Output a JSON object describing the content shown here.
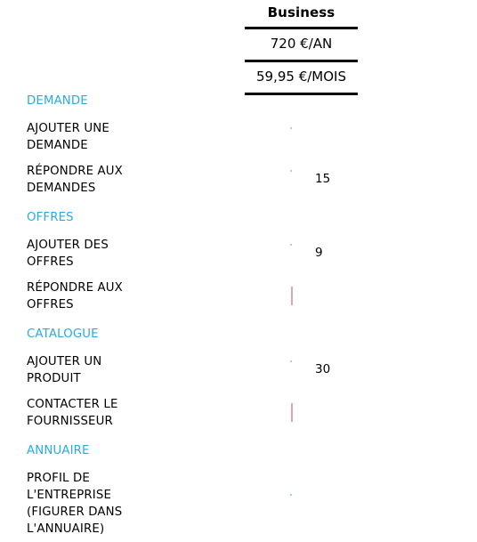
{
  "plan": {
    "name": "Business",
    "price_year": "720 €/AN",
    "price_month": "59,95 €/MOIS"
  },
  "colors": {
    "section_heading": "#29abe2",
    "label": "#000000",
    "rule": "#000000",
    "check_green": "#16b81c",
    "noentry_red": "#e02a1e"
  },
  "rows": [
    {
      "kind": "section",
      "label": "DEMANDE",
      "icon": "",
      "count": ""
    },
    {
      "kind": "feature",
      "label": "AJOUTER UNE DEMANDE",
      "icon": "check-icon",
      "count": ""
    },
    {
      "kind": "feature",
      "label": "RÉPONDRE AUX DEMANDES",
      "icon": "check-icon",
      "count": "15"
    },
    {
      "kind": "section",
      "label": "OFFRES",
      "icon": "",
      "count": ""
    },
    {
      "kind": "feature",
      "label": "AJOUTER DES OFFRES",
      "icon": "check-icon",
      "count": "9"
    },
    {
      "kind": "feature",
      "label": "RÉPONDRE AUX OFFRES",
      "icon": "no-entry-icon",
      "count": ""
    },
    {
      "kind": "section",
      "label": "CATALOGUE",
      "icon": "",
      "count": ""
    },
    {
      "kind": "feature",
      "label": "AJOUTER UN PRODUIT",
      "icon": "check-icon",
      "count": "30"
    },
    {
      "kind": "feature",
      "label": "CONTACTER LE FOURNISSEUR",
      "icon": "no-entry-icon",
      "count": ""
    },
    {
      "kind": "section",
      "label": "ANNUAIRE",
      "icon": "",
      "count": ""
    },
    {
      "kind": "feature",
      "label": "PROFIL DE L'ENTREPRISE (FIGURER DANS L'ANNUAIRE)",
      "icon": "check-icon",
      "count": ""
    }
  ]
}
